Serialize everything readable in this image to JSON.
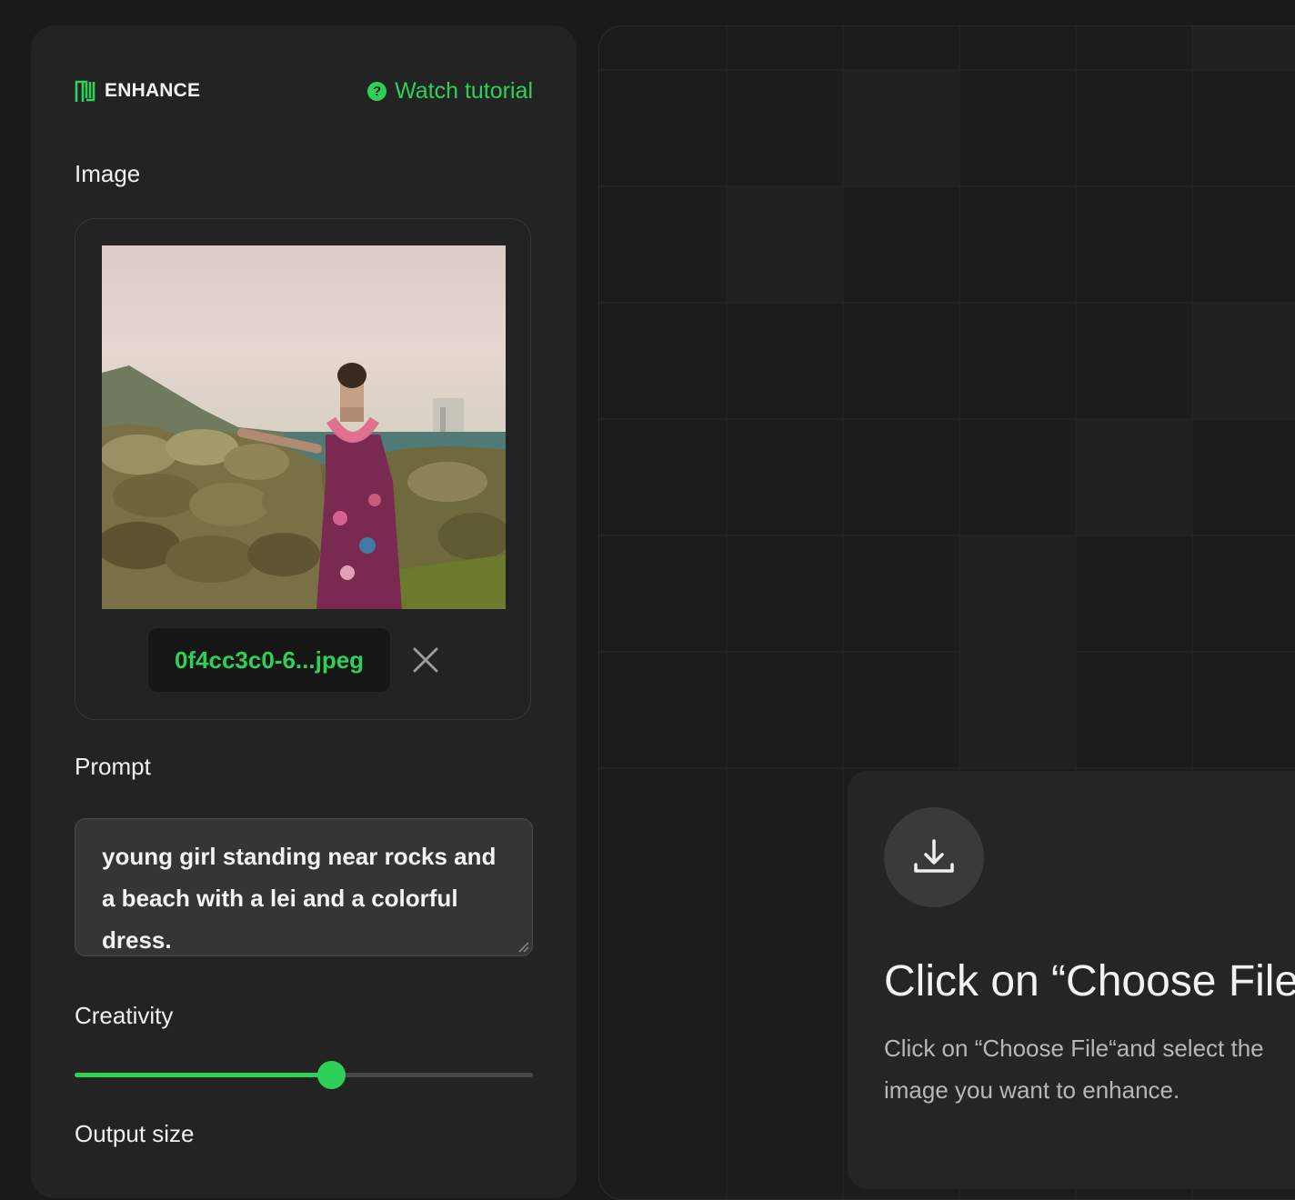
{
  "sidebar": {
    "brand": {
      "logo_icon": "enhance-logo-icon",
      "name": "ENHANCE"
    },
    "tutorial": {
      "icon": "question-circle-icon",
      "label": "Watch tutorial"
    },
    "image_section": {
      "label": "Image",
      "preview_subject": "uploaded-photo-preview",
      "filename": "0f4cc3c0-6...jpeg",
      "remove_icon": "close-icon"
    },
    "prompt_section": {
      "label": "Prompt",
      "value": "young girl standing near rocks and a beach with a lei and a colorful dress."
    },
    "creativity": {
      "label": "Creativity",
      "value": 0.56
    },
    "output_size": {
      "label": "Output size"
    }
  },
  "main": {
    "card": {
      "icon": "download-icon",
      "title": "Click on “Choose File",
      "description": "Click on “Choose File“and select the image you want to enhance."
    }
  },
  "colors": {
    "accent": "#2ed158",
    "background": "#1a1a1a",
    "panel": "#232323",
    "card": "#252525"
  }
}
